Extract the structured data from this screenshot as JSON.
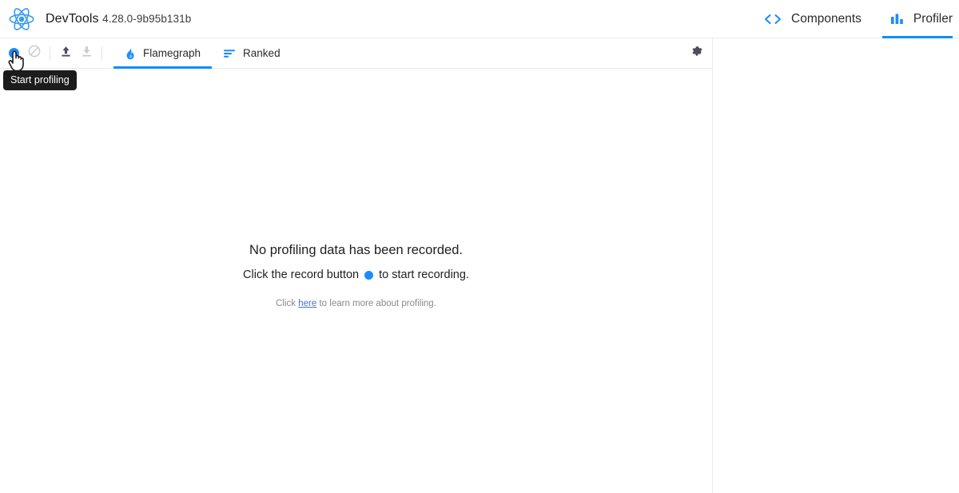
{
  "header": {
    "logo_icon": "react-logo-icon",
    "app_name": "DevTools",
    "version": "4.28.0-9b95b131b",
    "tabs": [
      {
        "label": "Components",
        "icon": "code-brackets-icon",
        "active": false
      },
      {
        "label": "Profiler",
        "icon": "bar-chart-icon",
        "active": true
      }
    ]
  },
  "toolbar": {
    "record_button": {
      "icon": "record-circle-icon",
      "label": "Start profiling",
      "enabled": true
    },
    "clear_button": {
      "icon": "no-entry-icon",
      "enabled": false
    },
    "load_button": {
      "icon": "upload-arrow-icon",
      "enabled": true
    },
    "save_button": {
      "icon": "download-arrow-icon",
      "enabled": false
    },
    "tabs": [
      {
        "label": "Flamegraph",
        "icon": "flame-icon",
        "active": true
      },
      {
        "label": "Ranked",
        "icon": "sort-bars-icon",
        "active": false
      }
    ],
    "settings_button": {
      "icon": "gear-icon"
    }
  },
  "tooltip": {
    "text": "Start profiling",
    "visible": true
  },
  "cursor": {
    "icon": "pointing-hand-cursor"
  },
  "main": {
    "empty_state": {
      "headline": "No profiling data has been recorded.",
      "instruction_prefix": "Click the record button",
      "instruction_suffix": "to start recording.",
      "record_dot_icon": "record-dot-icon",
      "help_prefix": "Click",
      "help_link": "here",
      "help_suffix": "to learn more about profiling."
    }
  },
  "colors": {
    "accent_blue": "#0e8df8",
    "record_blue": "#1a8cff",
    "link_blue": "#4b6fd6",
    "border_grey": "#eaeaea",
    "tooltip_bg": "#1c1c1c",
    "icon_dark": "#4a4f5c",
    "icon_disabled": "#c9ccd2"
  }
}
